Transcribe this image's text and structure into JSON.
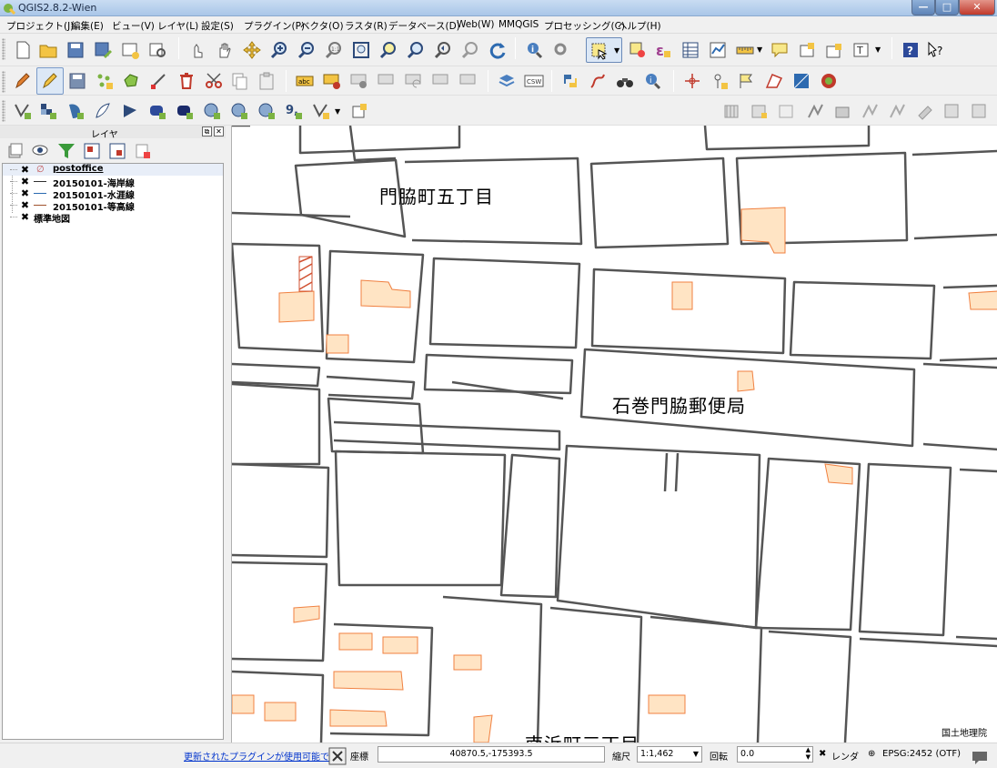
{
  "window": {
    "title": "QGIS2.8.2-Wien"
  },
  "menu": [
    "プロジェクト(J)",
    "編集(E)",
    "ビュー(V)",
    "レイヤ(L)",
    "設定(S)",
    "プラグイン(P)",
    "ベクタ(O)",
    "ラスタ(R)",
    "データベース(D)",
    "Web(W)",
    "MMQGIS",
    "プロセッシング(C)",
    "ヘルプ(H)"
  ],
  "layers_panel": {
    "title": "レイヤ",
    "layers": [
      {
        "name": "postoffice",
        "checked": true,
        "color": "#c05050"
      },
      {
        "name": "20150101-海岸線",
        "checked": true,
        "color": "#303030"
      },
      {
        "name": "20150101-水涯線",
        "checked": true,
        "color": "#2a6ab0"
      },
      {
        "name": "20150101-等高線",
        "checked": true,
        "color": "#a0522d"
      },
      {
        "name": "標準地図",
        "checked": true,
        "color": ""
      }
    ]
  },
  "map": {
    "labels": {
      "town": "門脇町五丁目",
      "post_office": "石巻門脇郵便局",
      "bottom_partial": "南浜町三丁目"
    },
    "attribution": "国土地理院",
    "building_fill": "#ffe4c4",
    "building_stroke": "#f08040",
    "road_stroke": "#555555"
  },
  "status": {
    "plugin_notice": "更新されたプラグインが使用可能です",
    "coordinate_label": "座標",
    "coordinate_value": "40870.5,-175393.5",
    "scale_label": "縮尺",
    "scale_value": "1:1,462",
    "rotation_label": "回転",
    "rotation_value": "0.0",
    "render_label": "レンダ",
    "crs": "EPSG:2452 (OTF)"
  }
}
